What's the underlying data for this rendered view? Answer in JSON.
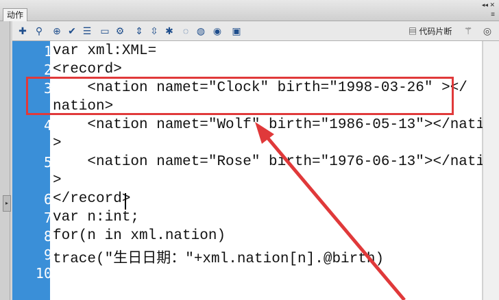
{
  "panel": {
    "tab_label": "动作",
    "window_controls": "◂◂ ✕",
    "menu_glyph": "≡"
  },
  "toolbar": {
    "icons": [
      "add-statement-icon",
      "find-icon",
      "target-icon",
      "check-syntax-icon",
      "auto-format-icon",
      "show-code-hint-icon",
      "debug-options-icon",
      "collapse-between-braces-icon",
      "collapse-selection-icon",
      "expand-all-icon",
      "apply-block-comment-icon",
      "apply-line-comment-icon",
      "remove-comment-icon",
      "show-hide-toolbox-icon"
    ],
    "snippets_label": "代码片断",
    "wand_icon": "magic-wand-icon",
    "help_icon": "help-icon"
  },
  "editor": {
    "line_numbers": [
      "1",
      "2",
      "3",
      "4",
      "5",
      "6",
      "7",
      "8",
      "9",
      "10"
    ],
    "lines": [
      "var xml:XML=",
      "<record>",
      "    <nation namet=\"Clock\" birth=\"1998-03-26\" ></",
      "nation>",
      "    <nation namet=\"Wolf\" birth=\"1986-05-13\"></nation",
      ">",
      "    <nation namet=\"Rose\" birth=\"1976-06-13\"></nation",
      ">",
      "</record>",
      "var n:int;",
      "for(n in xml.nation)",
      "trace(\"生日日期：\"+xml.nation[n].@birth)"
    ]
  },
  "annotation": {
    "highlight_color": "#e0393a",
    "gutter_color": "#3a8fd8"
  }
}
